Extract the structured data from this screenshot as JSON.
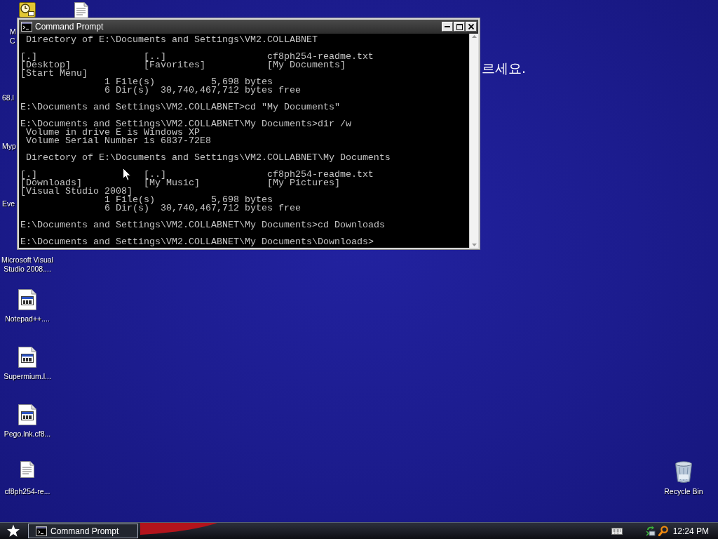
{
  "desktop": {
    "icons": [
      {
        "kind": "clock",
        "label_lines": [
          "M",
          "C"
        ]
      },
      {
        "kind": "document"
      },
      {
        "kind": "covered",
        "label": "68.l"
      },
      {
        "kind": "covered",
        "label": "Myp"
      },
      {
        "kind": "covered",
        "label": "Eve"
      },
      {
        "kind": "covered",
        "label": "Microsoft Visual Studio 2008...."
      },
      {
        "kind": "program",
        "label": "Notepad++...."
      },
      {
        "kind": "program",
        "label": "Supermium.l..."
      },
      {
        "kind": "program",
        "label": "Pego.lnk.cf8..."
      },
      {
        "kind": "document",
        "label": "cf8ph254-re..."
      },
      {
        "kind": "recycle_bin",
        "label": "Recycle Bin"
      }
    ],
    "message": "르세요."
  },
  "window": {
    "title": "Command Prompt",
    "console": {
      "blocks": [
        {
          "lines": [
            " Directory of E:\\Documents and Settings\\VM2.COLLABNET"
          ]
        },
        {
          "entries": [
            "[.]",
            "[..]",
            "cf8ph254-readme.txt",
            "[Desktop]",
            "[Favorites]",
            "[My Documents]",
            "[Start Menu]"
          ],
          "lines": [
            "               1 File(s)          5,698 bytes",
            "               6 Dir(s)  30,740,467,712 bytes free"
          ]
        },
        {
          "lines": [
            "E:\\Documents and Settings\\VM2.COLLABNET>cd \"My Documents\""
          ]
        },
        {
          "lines": [
            "E:\\Documents and Settings\\VM2.COLLABNET\\My Documents>dir /w",
            " Volume in drive E is Windows XP",
            " Volume Serial Number is 6837-72E8"
          ]
        },
        {
          "lines": [
            " Directory of E:\\Documents and Settings\\VM2.COLLABNET\\My Documents"
          ]
        },
        {
          "entries": [
            "[.]",
            "[..]",
            "cf8ph254-readme.txt",
            "[Downloads]",
            "[My Music]",
            "[My Pictures]",
            "[Visual Studio 2008]"
          ],
          "lines": [
            "               1 File(s)          5,698 bytes",
            "               6 Dir(s)  30,740,467,712 bytes free"
          ]
        },
        {
          "lines": [
            "E:\\Documents and Settings\\VM2.COLLABNET\\My Documents>cd Downloads"
          ]
        },
        {
          "lines": [
            "E:\\Documents and Settings\\VM2.COLLABNET\\My Documents\\Downloads>"
          ]
        }
      ]
    }
  },
  "taskbar": {
    "tasks": [
      {
        "label": "Command Prompt",
        "selected": true
      }
    ],
    "clock": "12:24 PM"
  }
}
